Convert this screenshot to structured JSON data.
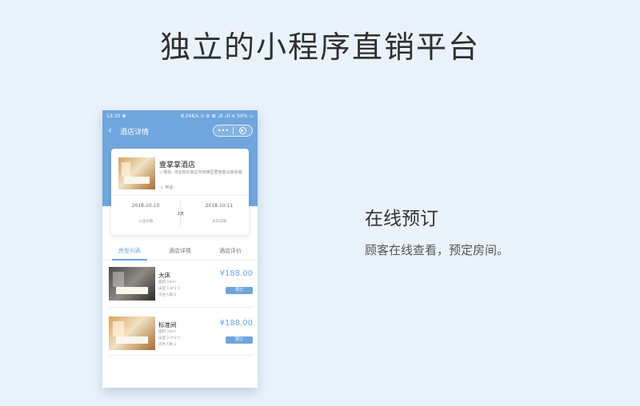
{
  "headline": "独立的小程序直销平台",
  "side": {
    "title": "在线预订",
    "description": "顾客在线查看，预定房间。"
  },
  "phone": {
    "status": {
      "time": "13:30",
      "right": "8.04K/s ⊙ ⚙ ⊠ .ıll .ıll ≋ 59% ▭"
    },
    "nav": {
      "back_icon": "‹",
      "title": "酒店详情",
      "more_icon": "•••"
    },
    "hotel": {
      "name": "壹掌掌酒店",
      "address": "地址: 河北省石家庄市桥西区君宫金马商贸城",
      "phone": "电话:",
      "checkin_date": "2018-10-10",
      "checkin_label": "入住日期",
      "checkout_date": "2018-10-11",
      "checkout_label": "退房日期",
      "nights": "1天"
    },
    "tabs": [
      {
        "label": "房型列表",
        "active": true
      },
      {
        "label": "酒店详情",
        "active": false
      },
      {
        "label": "酒店评价",
        "active": false
      }
    ],
    "rooms": [
      {
        "name": "大床",
        "area": "面积:10m²",
        "bed": "床型:1.8*2.0",
        "capacity": "可住人数:2",
        "price": "¥188.00",
        "book": "预订"
      },
      {
        "name": "标准间",
        "area": "面积:10m²",
        "bed": "床型:1.5*2.0",
        "capacity": "可住人数:2",
        "price": "¥188.00",
        "book": "预订"
      }
    ]
  },
  "colors": {
    "accent": "#6fa6dd",
    "background": "#eaf3fc"
  }
}
